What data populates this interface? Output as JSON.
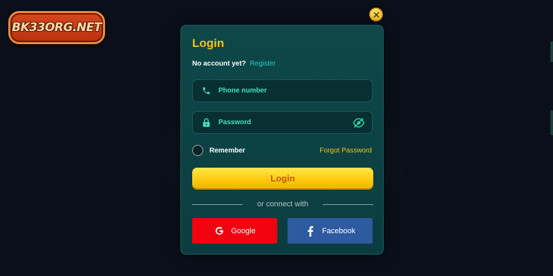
{
  "brand": {
    "logo_text": "BK33ORG.NET"
  },
  "modal": {
    "title": "Login",
    "no_account_text": "No account yet?",
    "register_link": "Register",
    "phone_placeholder": "Phone number",
    "password_placeholder": "Password",
    "remember_label": "Remember",
    "forgot_link": "Forgot Password",
    "login_button": "Login",
    "divider_text": "or connect with",
    "google_button": "Google",
    "facebook_button": "Facebook"
  },
  "icons": {
    "close": "close-icon",
    "phone": "phone-icon",
    "lock": "lock-icon",
    "eye": "eye-slash-icon",
    "google": "google-icon",
    "facebook": "facebook-icon"
  },
  "colors": {
    "background": "#0b0f1a",
    "modal": "#0f4749",
    "accent_yellow": "#f3c316",
    "accent_teal": "#1fd3b6",
    "google_red": "#f0030f",
    "facebook_blue": "#2d5aa0"
  }
}
